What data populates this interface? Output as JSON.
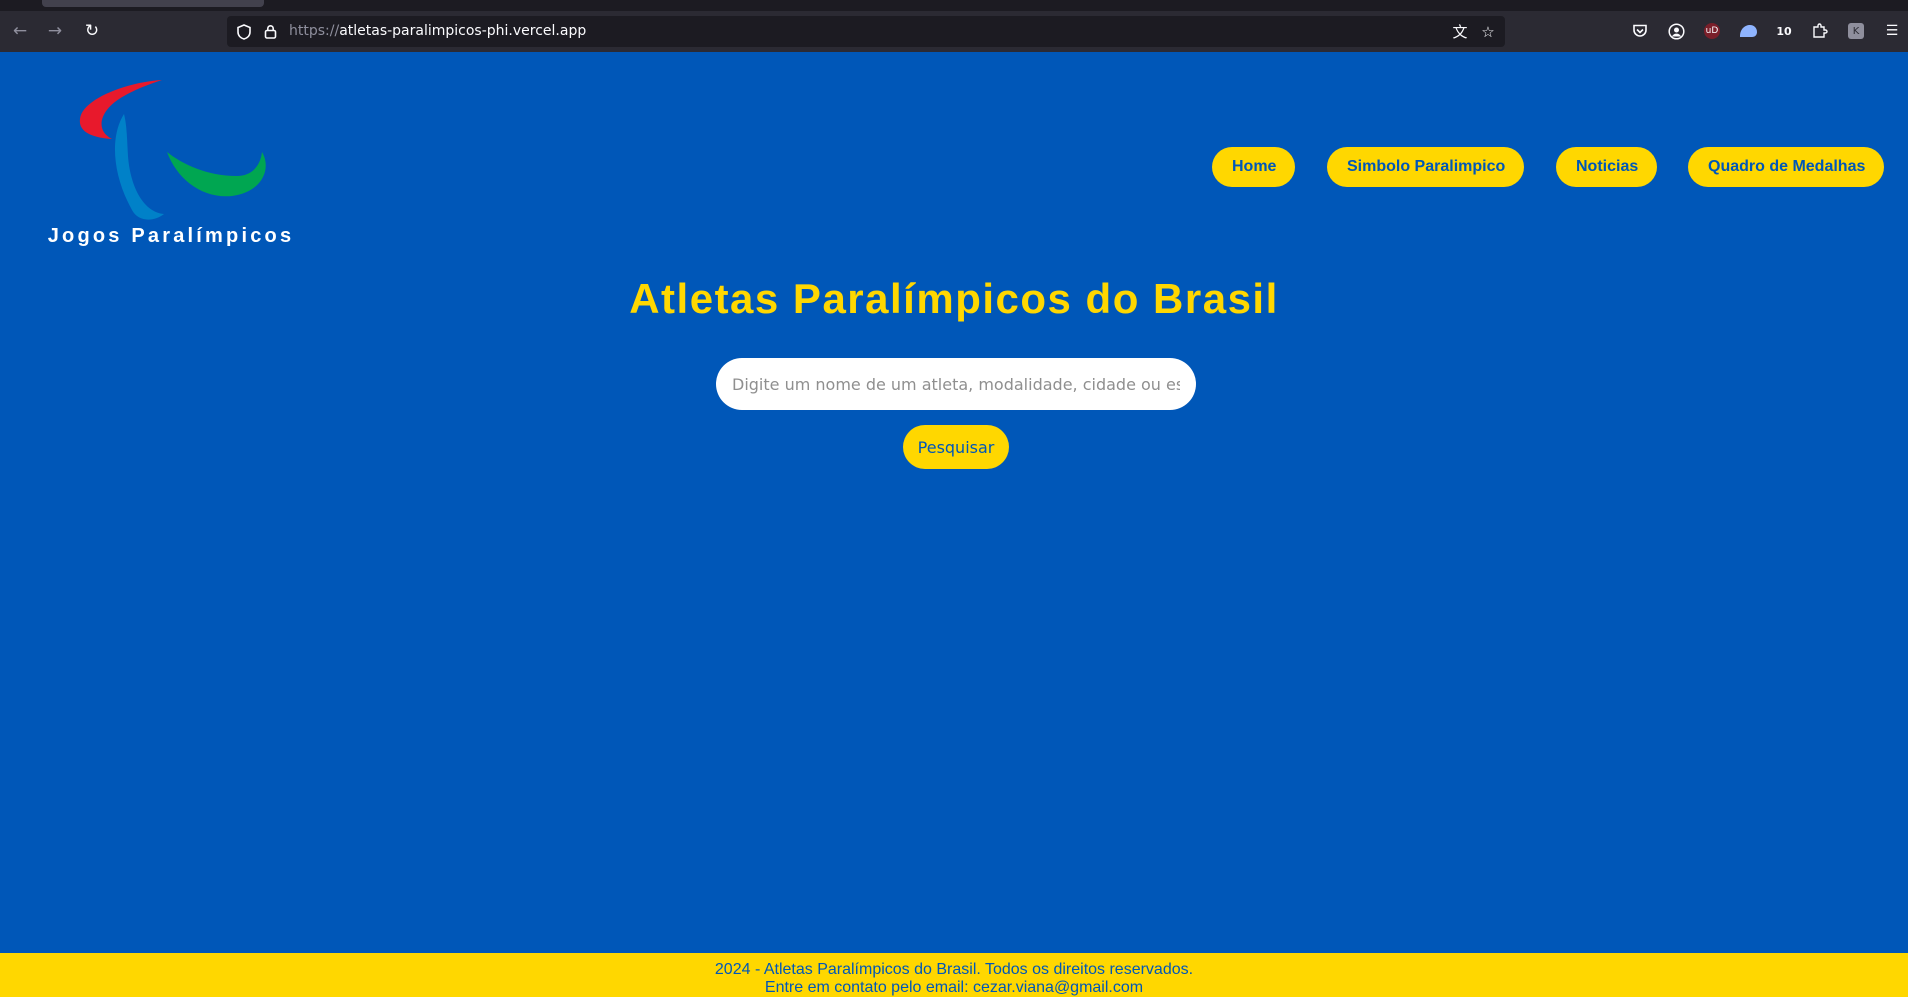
{
  "browser": {
    "url_scheme": "https://",
    "url_host": "atletas-paralimpicos-phi.vercel.app",
    "icons": [
      "back-icon",
      "forward-icon",
      "reload-icon",
      "shield-icon",
      "lock-icon",
      "translate-icon",
      "bookmark-star-icon",
      "pocket-icon",
      "account-icon",
      "ublock-icon",
      "extension-ghost-icon",
      "extension-10-icon",
      "extensions-puzzle-icon",
      "extension-k-icon",
      "menu-icon"
    ],
    "ext_10_label": "10",
    "ext_k_label": "K",
    "ext_ud_label": "uD"
  },
  "header": {
    "logo_text": "Jogos Paralímpicos",
    "logo_colors": {
      "red": "#e8192c",
      "blue": "#0081c8",
      "green": "#00a651"
    }
  },
  "nav": {
    "items": [
      {
        "label": "Home"
      },
      {
        "label": "Simbolo Paralimpico"
      },
      {
        "label": "Noticias"
      },
      {
        "label": "Quadro de Medalhas"
      }
    ]
  },
  "main": {
    "title": "Atletas Paralímpicos do Brasil",
    "search_placeholder": "Digite um nome de um atleta, modalidade, cidade ou estado",
    "search_value": "",
    "search_button": "Pesquisar"
  },
  "footer": {
    "line1": "2024 - Atletas Paralímpicos do Brasil. Todos os direitos reservados.",
    "line2": "Entre em contato pelo email: cezar.viana@gmail.com"
  },
  "colors": {
    "background": "#0057b8",
    "accent_yellow": "#ffd700",
    "text_white": "#ffffff"
  }
}
